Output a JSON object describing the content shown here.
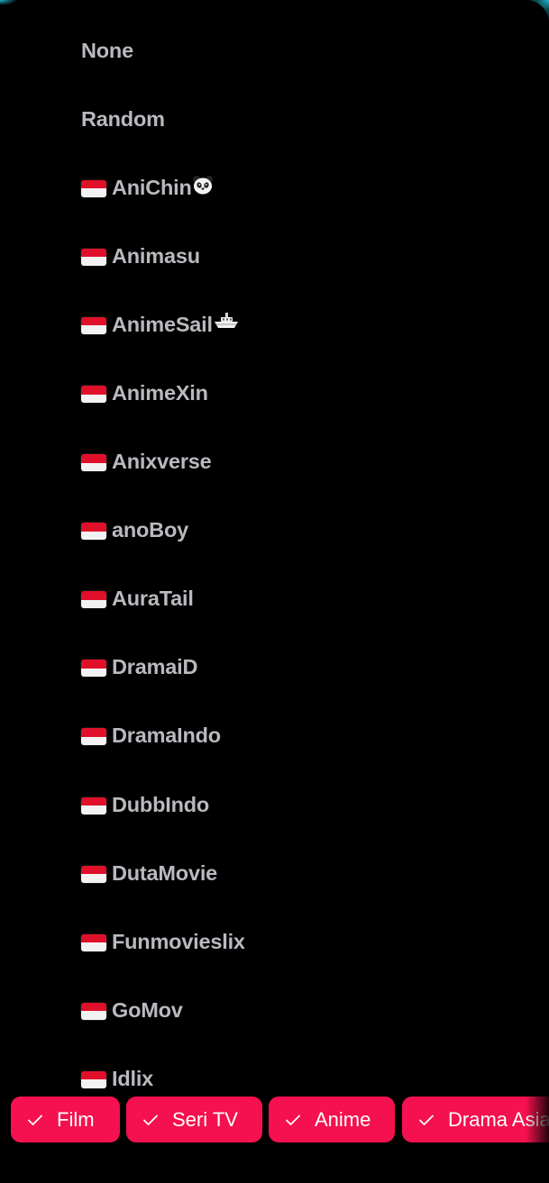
{
  "providers": [
    {
      "label": "None",
      "flag": false
    },
    {
      "label": "Random",
      "flag": false
    },
    {
      "label": "AniChin",
      "flag": true,
      "emoji": "panda-icon"
    },
    {
      "label": "Animasu",
      "flag": true
    },
    {
      "label": "AnimeSail",
      "flag": true,
      "emoji": "ship-icon"
    },
    {
      "label": "AnimeXin",
      "flag": true
    },
    {
      "label": "Anixverse",
      "flag": true
    },
    {
      "label": "anoBoy",
      "flag": true
    },
    {
      "label": "AuraTail",
      "flag": true
    },
    {
      "label": "DramaiD",
      "flag": true
    },
    {
      "label": "DramaIndo",
      "flag": true
    },
    {
      "label": "DubbIndo",
      "flag": true
    },
    {
      "label": "DutaMovie",
      "flag": true
    },
    {
      "label": "Funmovieslix",
      "flag": true
    },
    {
      "label": "GoMov",
      "flag": true
    },
    {
      "label": "Idlix",
      "flag": true
    }
  ],
  "filters": {
    "film": "Film",
    "seri_tv": "Seri TV",
    "anime": "Anime",
    "drama_asia": "Drama Asia"
  },
  "colors": {
    "chip_bg": "#f5104f",
    "item_text": "#b9b9bf",
    "accent": "#1fb5c9",
    "flag_red": "#e0102a"
  }
}
